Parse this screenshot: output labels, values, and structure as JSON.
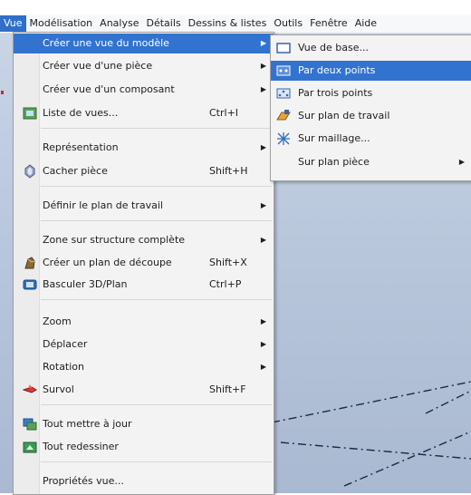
{
  "menubar": {
    "items": [
      "Vue",
      "Modélisation",
      "Analyse",
      "Détails",
      "Dessins & listes",
      "Outils",
      "Fenêtre",
      "Aide"
    ]
  },
  "menu": {
    "items": [
      {
        "label": "Créer une vue du modèle",
        "submenu": true,
        "highlighted": true
      },
      {
        "label": "Créer vue d'une pièce",
        "submenu": true
      },
      {
        "label": "Créer vue d'un composant",
        "submenu": true
      },
      {
        "label": "Liste de vues...",
        "shortcut": "Ctrl+I",
        "icon": "view-list-icon"
      },
      {
        "label": "Représentation",
        "submenu": true
      },
      {
        "label": "Cacher pièce",
        "shortcut": "Shift+H",
        "icon": "hide-part-icon"
      },
      {
        "label": "Définir le plan de travail",
        "submenu": true
      },
      {
        "label": "Zone sur structure complète",
        "submenu": true
      },
      {
        "label": "Créer un plan de découpe",
        "shortcut": "Shift+X",
        "icon": "clip-plane-icon"
      },
      {
        "label": "Basculer 3D/Plan",
        "shortcut": "Ctrl+P",
        "icon": "toggle-3d-icon"
      },
      {
        "label": "Zoom",
        "submenu": true
      },
      {
        "label": "Déplacer",
        "submenu": true
      },
      {
        "label": "Rotation",
        "submenu": true
      },
      {
        "label": "Survol",
        "shortcut": "Shift+F",
        "icon": "fly-icon"
      },
      {
        "label": "Tout mettre à jour",
        "icon": "update-all-icon"
      },
      {
        "label": "Tout redessiner",
        "icon": "redraw-all-icon"
      },
      {
        "label": "Propriétés vue..."
      }
    ]
  },
  "submenu": {
    "items": [
      {
        "label": "Vue de base...",
        "icon": "basic-view-icon"
      },
      {
        "label": "Par deux points",
        "icon": "two-points-icon",
        "highlighted": true
      },
      {
        "label": "Par trois points",
        "icon": "three-points-icon"
      },
      {
        "label": "Sur plan de travail",
        "icon": "work-plane-icon"
      },
      {
        "label": "Sur maillage...",
        "icon": "grid-icon"
      },
      {
        "label": "Sur plan pièce",
        "submenu": true
      }
    ]
  },
  "colors": {
    "highlight": "#3273d0",
    "menu_bg": "#f3f3f3",
    "viewport": "#b9c7dc"
  }
}
